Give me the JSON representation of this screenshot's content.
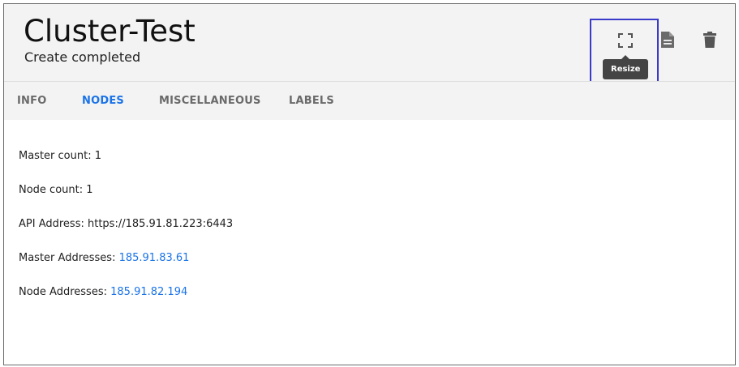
{
  "header": {
    "title": "Cluster-Test",
    "subtitle": "Create completed"
  },
  "toolbar": {
    "resize_icon": "fullscreen-corners-icon",
    "document_icon": "document-icon",
    "delete_icon": "trash-icon",
    "tooltip": "Resize",
    "highlight_color": "#3b3bc9"
  },
  "tabs": [
    {
      "label": "INFO",
      "active": false
    },
    {
      "label": "NODES",
      "active": true
    },
    {
      "label": "MISCELLANEOUS",
      "active": false
    },
    {
      "label": "LABELS",
      "active": false
    }
  ],
  "details": {
    "master_count_label": "Master count: ",
    "master_count_value": "1",
    "node_count_label": "Node count: ",
    "node_count_value": "1",
    "api_address_label": "API Address: ",
    "api_address_value": "https://185.91.81.223:6443",
    "master_addresses_label": "Master Addresses: ",
    "master_addresses_value": "185.91.83.61",
    "node_addresses_label": "Node Addresses: ",
    "node_addresses_value": "185.91.82.194"
  },
  "colors": {
    "accent": "#1a73e8",
    "header_bg": "#f3f3f3"
  }
}
